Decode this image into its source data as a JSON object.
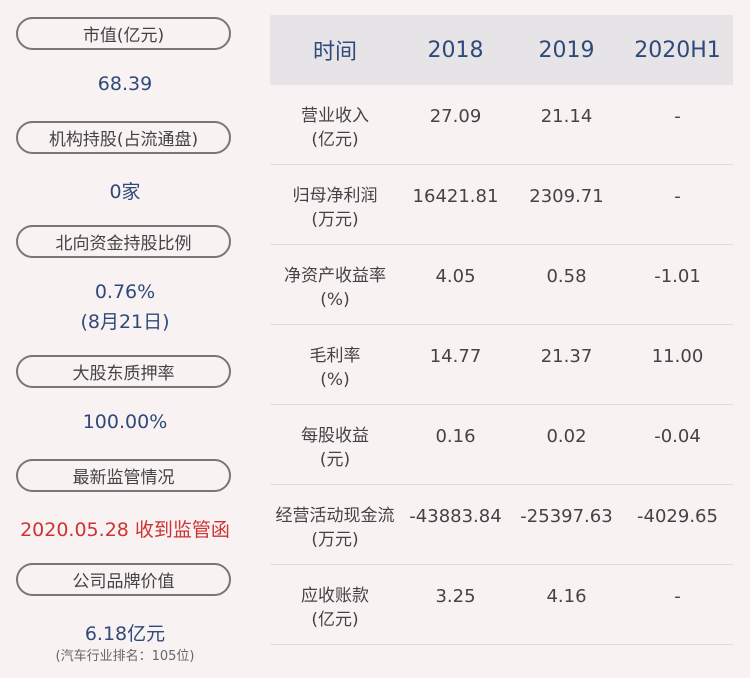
{
  "left_panel": [
    {
      "label": "市值(亿元)",
      "value": "68.39"
    },
    {
      "label": "机构持股(占流通盘)",
      "value": "0家"
    },
    {
      "label": "北向资金持股比例",
      "value": "0.76%",
      "value2": "(8月21日)"
    },
    {
      "label": "大股东质押率",
      "value": "100.00%"
    },
    {
      "label": "最新监管情况",
      "value": "2020.05.28 收到监管函",
      "value_color": "#cc3333"
    },
    {
      "label": "公司品牌价值",
      "value": "6.18亿元",
      "note": "(汽车行业排名：105位)"
    }
  ],
  "table": {
    "headers": [
      "时间",
      "2018",
      "2019",
      "2020H1"
    ],
    "rows": [
      {
        "name": "营业收入",
        "unit": "(亿元)",
        "values": [
          "27.09",
          "21.14",
          "-"
        ]
      },
      {
        "name": "归母净利润",
        "unit": "(万元)",
        "values": [
          "16421.81",
          "2309.71",
          "-"
        ]
      },
      {
        "name": "净资产收益率",
        "unit": "(%)",
        "values": [
          "4.05",
          "0.58",
          "-1.01"
        ]
      },
      {
        "name": "毛利率",
        "unit": "(%)",
        "values": [
          "14.77",
          "21.37",
          "11.00"
        ]
      },
      {
        "name": "每股收益",
        "unit": "(元)",
        "values": [
          "0.16",
          "0.02",
          "-0.04"
        ]
      },
      {
        "name": "经营活动现金流",
        "unit": "(万元)",
        "values": [
          "-43883.84",
          "-25397.63",
          "-4029.65"
        ]
      },
      {
        "name": "应收账款",
        "unit": "(亿元)",
        "values": [
          "3.25",
          "4.16",
          "-"
        ]
      }
    ]
  },
  "colors": {
    "background": "#f9f2f3",
    "header_bg": "#e7e4e8",
    "value_blue": "#2f4a7a",
    "alert_red": "#cc3333"
  }
}
